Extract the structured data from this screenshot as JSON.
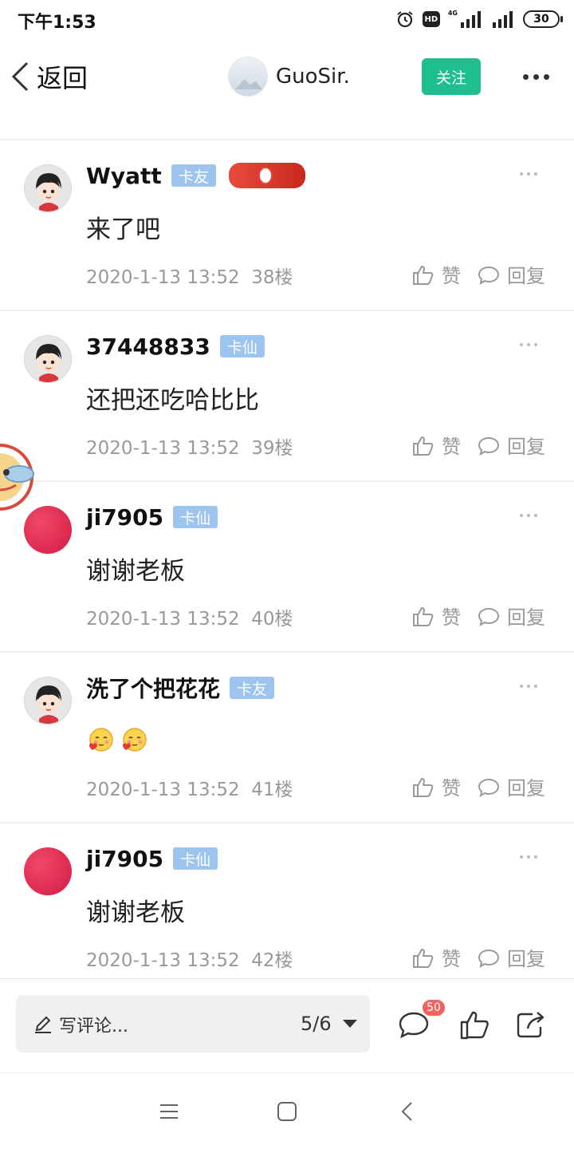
{
  "status_bar": {
    "time": "下午1:53",
    "hd": "HD",
    "network": "4G",
    "battery": "30"
  },
  "nav": {
    "back_label": "返回",
    "username": "GuoSir.",
    "follow_label": "关注"
  },
  "posts": [
    {
      "user": "Wyatt",
      "badge": "卡友",
      "avatar": "cartoon-girl-avatar",
      "content": "来了吧",
      "time": "2020-1-13 13:52",
      "floor": "38楼",
      "like": "赞",
      "reply": "回复"
    },
    {
      "user": "37448833",
      "badge": "卡仙",
      "avatar": "cartoon-girl-avatar",
      "content": "还把还吃哈比比",
      "time": "2020-1-13 13:52",
      "floor": "39楼",
      "like": "赞",
      "reply": "回复"
    },
    {
      "user": "ji7905",
      "badge": "卡仙",
      "avatar": "red-circle-avatar",
      "content": "谢谢老板",
      "time": "2020-1-13 13:52",
      "floor": "40楼",
      "like": "赞",
      "reply": "回复"
    },
    {
      "user": "洗了个把花花",
      "badge": "卡友",
      "avatar": "cartoon-girl-avatar",
      "content": "",
      "time": "2020-1-13 13:52",
      "floor": "41楼",
      "like": "赞",
      "reply": "回复"
    },
    {
      "user": "ji7905",
      "badge": "卡仙",
      "avatar": "red-circle-avatar",
      "content": "谢谢老板",
      "time": "2020-1-13 13:52",
      "floor": "42楼",
      "like": "赞",
      "reply": "回复"
    }
  ],
  "bottom_bar": {
    "comment_placeholder": "写评论...",
    "page_indicator": "5/6",
    "comment_count": "50"
  },
  "colors": {
    "accent_green": "#1fbf8f",
    "badge_blue": "#9cc4ef",
    "count_red": "#f56262"
  }
}
